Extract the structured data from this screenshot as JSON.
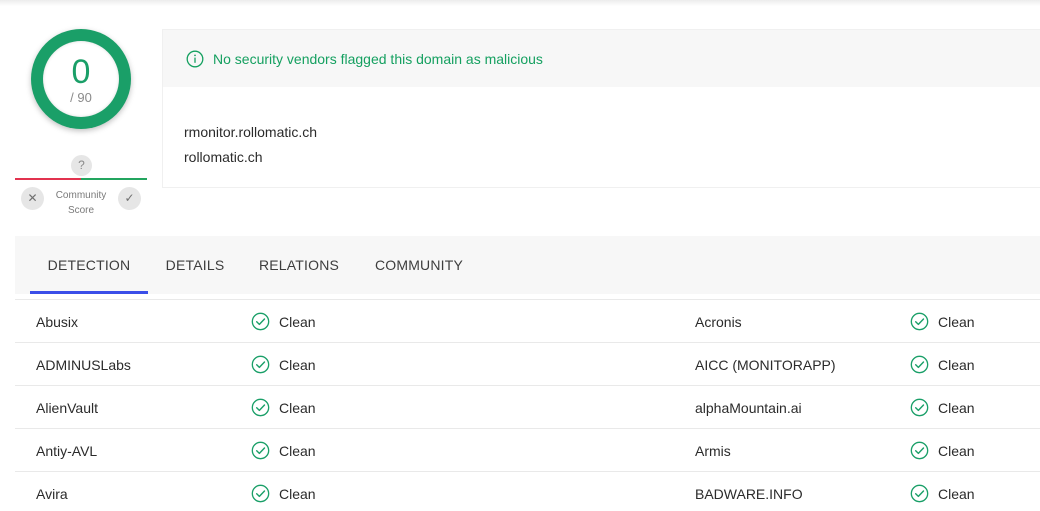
{
  "score": {
    "detections": "0",
    "total": "/ 90"
  },
  "community": {
    "unknown_label": "?",
    "label": "Community Score",
    "down_symbol": "✕",
    "up_symbol": "✓"
  },
  "banner": {
    "icon": "info-icon",
    "message": "No security vendors flagged this domain as malicious",
    "color": "#15a060"
  },
  "domains": [
    "rmonitor.rollomatic.ch",
    "rollomatic.ch"
  ],
  "tabs": [
    {
      "label": "DETECTION",
      "active": true
    },
    {
      "label": "DETAILS",
      "active": false
    },
    {
      "label": "RELATIONS",
      "active": false
    },
    {
      "label": "COMMUNITY",
      "active": false
    }
  ],
  "results": [
    {
      "left": {
        "vendor": "Abusix",
        "result": "Clean"
      },
      "right": {
        "vendor": "Acronis",
        "result": "Clean"
      }
    },
    {
      "left": {
        "vendor": "ADMINUSLabs",
        "result": "Clean"
      },
      "right": {
        "vendor": "AICC (MONITORAPP)",
        "result": "Clean"
      }
    },
    {
      "left": {
        "vendor": "AlienVault",
        "result": "Clean"
      },
      "right": {
        "vendor": "alphaMountain.ai",
        "result": "Clean"
      }
    },
    {
      "left": {
        "vendor": "Antiy-AVL",
        "result": "Clean"
      },
      "right": {
        "vendor": "Armis",
        "result": "Clean"
      }
    },
    {
      "left": {
        "vendor": "Avira",
        "result": "Clean"
      },
      "right": {
        "vendor": "BADWARE.INFO",
        "result": "Clean"
      }
    }
  ],
  "colors": {
    "accent": "#3b4ee8",
    "clean": "#1a9f68",
    "malicious": "#e2334f"
  }
}
